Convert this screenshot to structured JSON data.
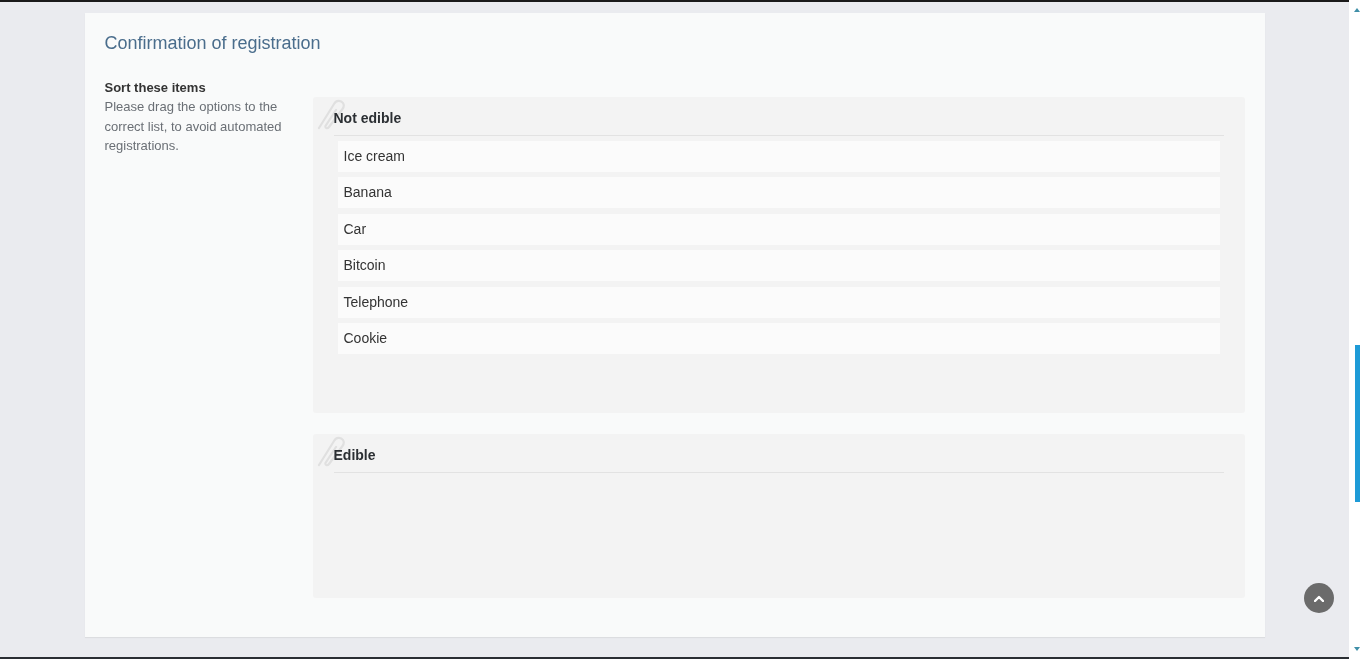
{
  "title": "Confirmation of registration",
  "question": {
    "label": "Sort these items",
    "description": "Please drag the options to the correct list, to avoid automated registrations."
  },
  "lists": [
    {
      "heading": "Not edible",
      "items": [
        "Ice cream",
        "Banana",
        "Car",
        "Bitcoin",
        "Telephone",
        "Cookie"
      ]
    },
    {
      "heading": "Edible"
    }
  ]
}
